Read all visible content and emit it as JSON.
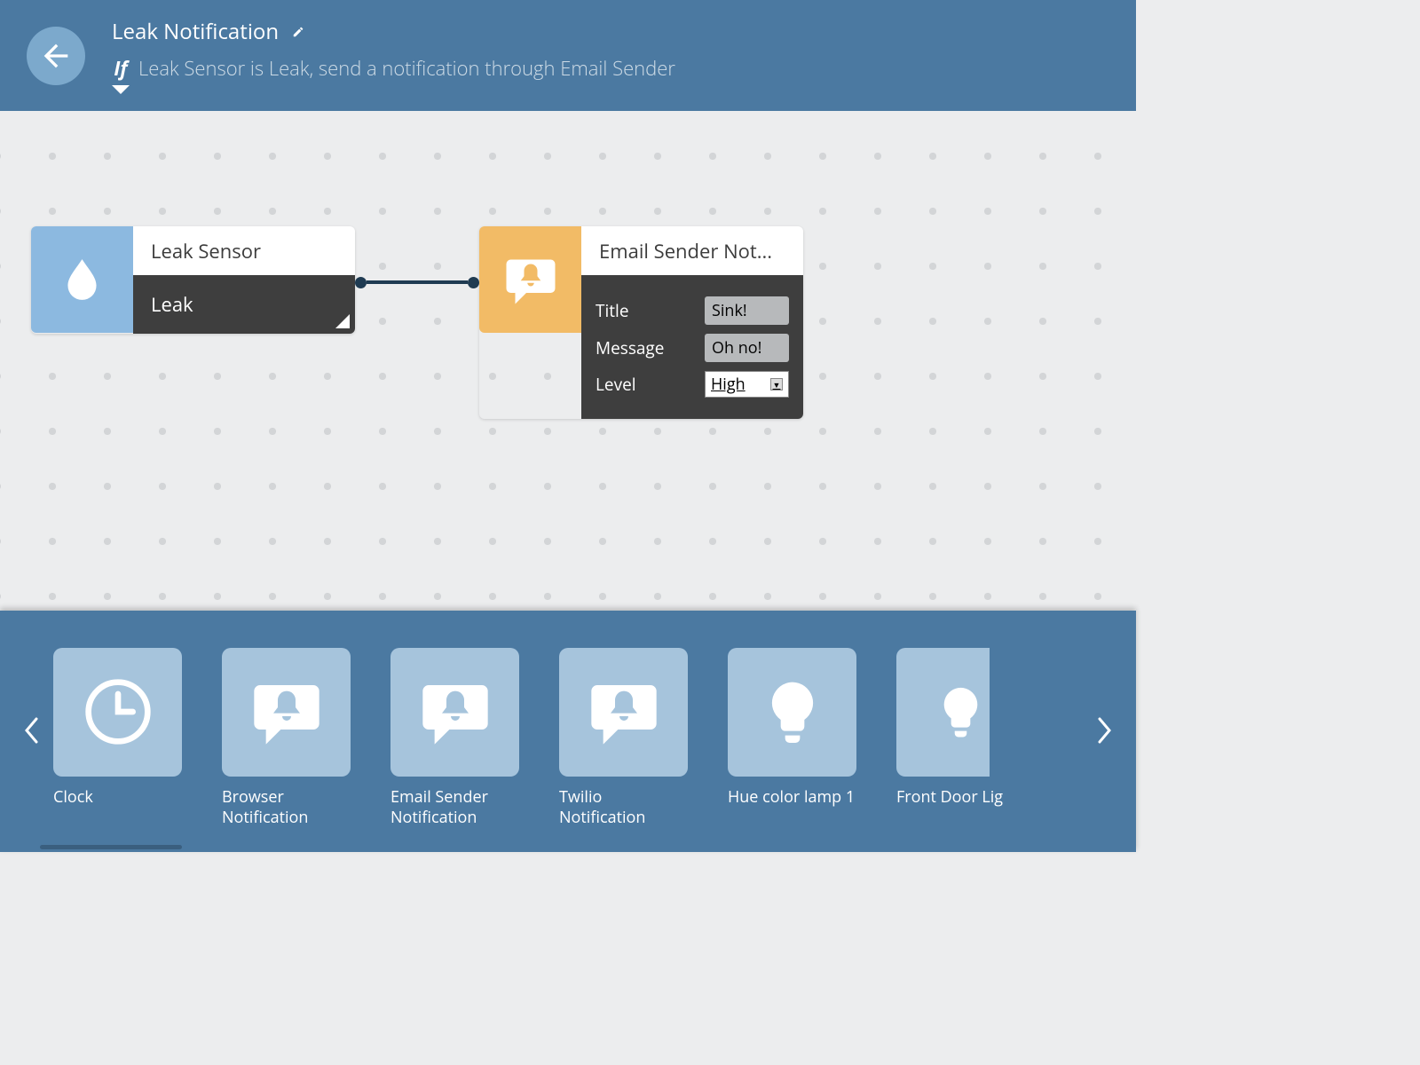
{
  "header": {
    "title": "Leak Notification",
    "if_label": "If",
    "description": "Leak Sensor is Leak, send a notification through Email Sender"
  },
  "canvas": {
    "trigger": {
      "title": "Leak Sensor",
      "condition": "Leak"
    },
    "action": {
      "title": "Email Sender Not...",
      "fields": {
        "title_label": "Title",
        "title_value": "Sink!",
        "message_label": "Message",
        "message_value": "Oh no!",
        "level_label": "Level",
        "level_value": "High"
      }
    }
  },
  "tray": {
    "items": [
      {
        "label": "Clock",
        "icon": "clock"
      },
      {
        "label": "Browser Notification",
        "icon": "bell-chat"
      },
      {
        "label": "Email Sender Notification",
        "icon": "bell-chat"
      },
      {
        "label": "Twilio Notification",
        "icon": "bell-chat"
      },
      {
        "label": "Hue color lamp 1",
        "icon": "bulb"
      },
      {
        "label": "Front Door Lig",
        "icon": "bulb"
      }
    ]
  }
}
